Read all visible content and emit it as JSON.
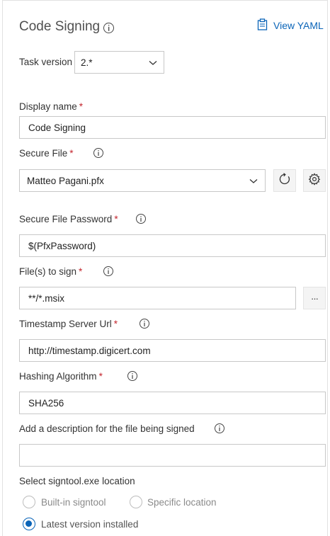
{
  "header": {
    "title": "Code Signing",
    "view_yaml": "View YAML"
  },
  "task_version": {
    "label": "Task version",
    "value": "2.*"
  },
  "display_name": {
    "label": "Display name",
    "value": "Code Signing"
  },
  "secure_file": {
    "label": "Secure File",
    "value": "Matteo Pagani.pfx"
  },
  "secure_file_password": {
    "label": "Secure File Password",
    "value": "$(PfxPassword)"
  },
  "files_to_sign": {
    "label": "File(s) to sign",
    "value": "**/*.msix",
    "browse": "···"
  },
  "timestamp_url": {
    "label": "Timestamp Server Url",
    "value": "http://timestamp.digicert.com"
  },
  "hashing_algorithm": {
    "label": "Hashing Algorithm",
    "value": "SHA256"
  },
  "description": {
    "label": "Add a description for the file being signed",
    "value": ""
  },
  "signtool": {
    "label": "Select signtool.exe location",
    "options": [
      {
        "label": "Built-in signtool",
        "selected": false
      },
      {
        "label": "Specific location",
        "selected": false
      },
      {
        "label": "Latest version installed",
        "selected": true
      }
    ]
  },
  "required_marker": "*",
  "colors": {
    "accent": "#0a64b8",
    "required": "#c4262e"
  }
}
